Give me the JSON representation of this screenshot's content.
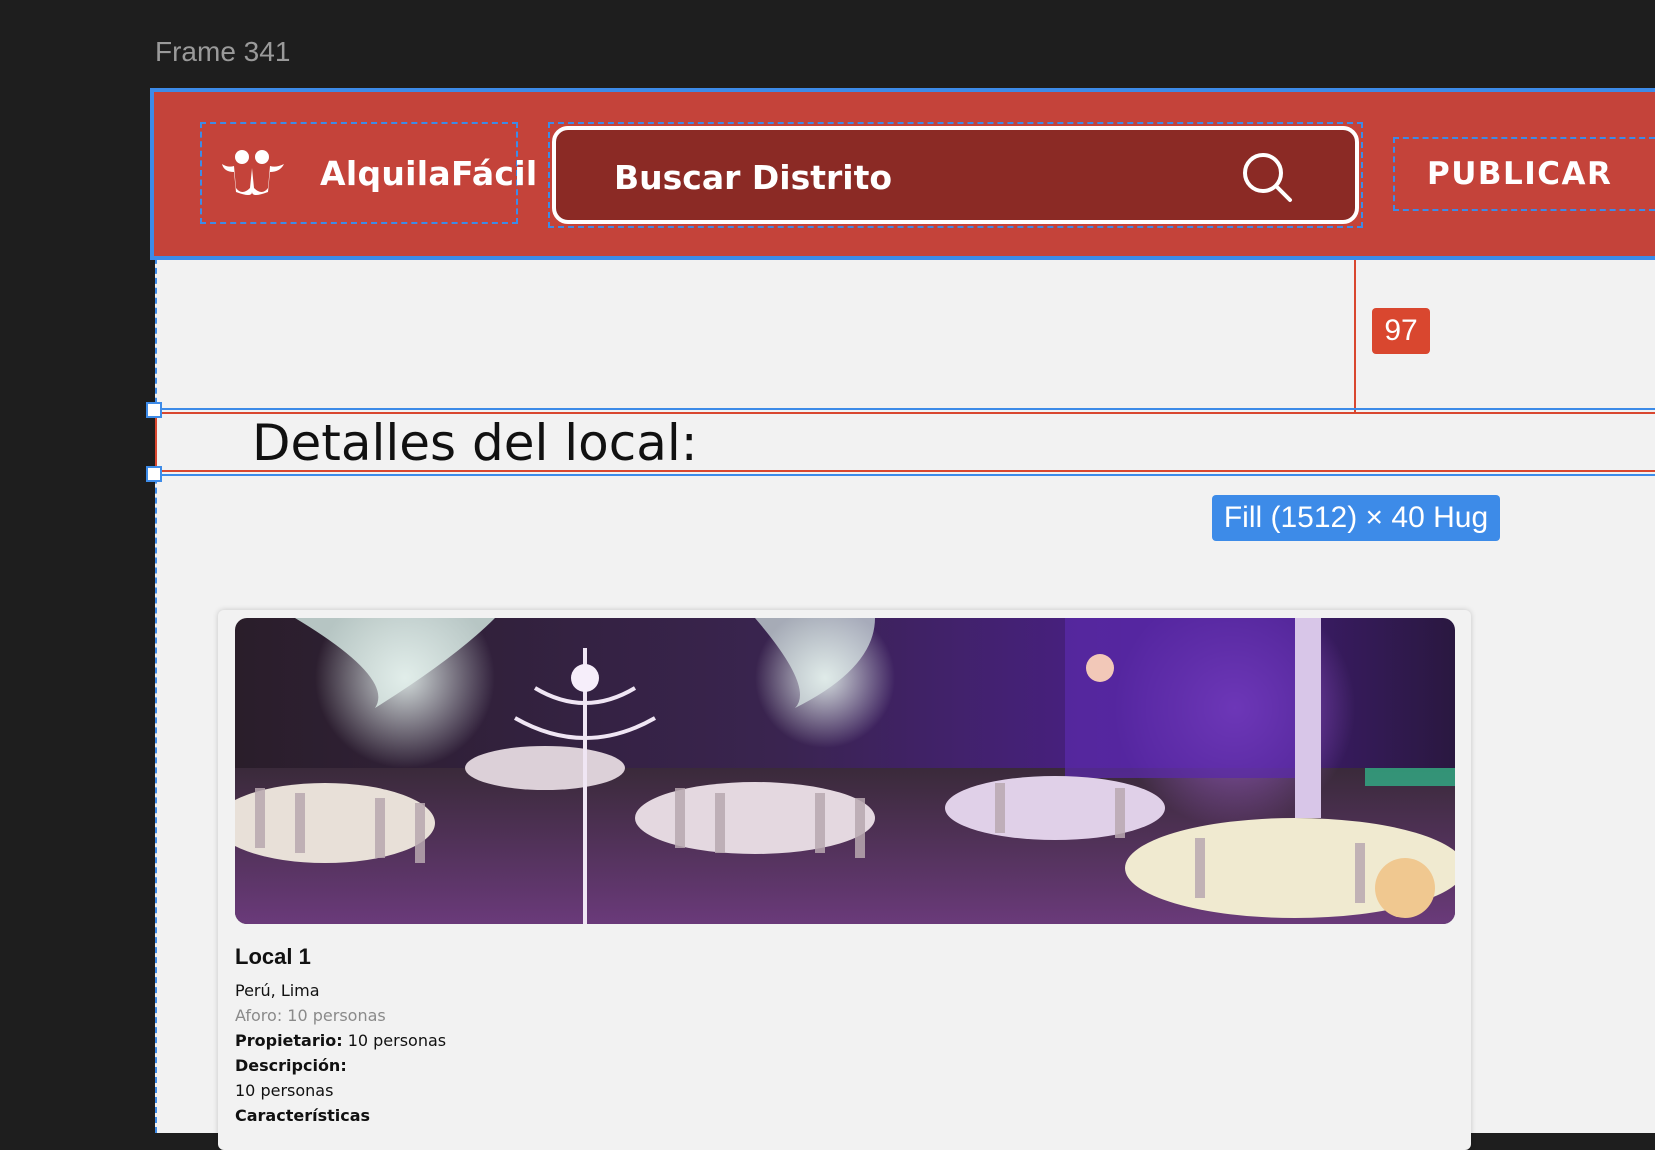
{
  "canvas": {
    "frame_label": "Frame 341",
    "spacing_value": "97",
    "dimension_label": "Fill (1512) × 40 Hug",
    "colors": {
      "canvas_bg": "#1e1e1e",
      "selection": "#3d8be8",
      "spacing": "#d9472f"
    }
  },
  "header": {
    "brand": "AlquilaFácil",
    "logo_icon": "people-icon",
    "search": {
      "placeholder": "Buscar Distrito",
      "icon": "search-icon"
    },
    "publish_label": "PUBLICAR",
    "colors": {
      "bg": "#c4433a",
      "search_bg": "#8b2a25"
    }
  },
  "main": {
    "title": "Detalles del local:",
    "card": {
      "image": "event-hall-photo",
      "name": "Local 1",
      "location": "Perú, Lima",
      "capacity": "Aforo: 10 personas",
      "owner_label": "Propietario:",
      "owner_value": " 10 personas",
      "description_label": "Descripción:",
      "description_value": "10 personas",
      "features_label": "Características"
    }
  }
}
